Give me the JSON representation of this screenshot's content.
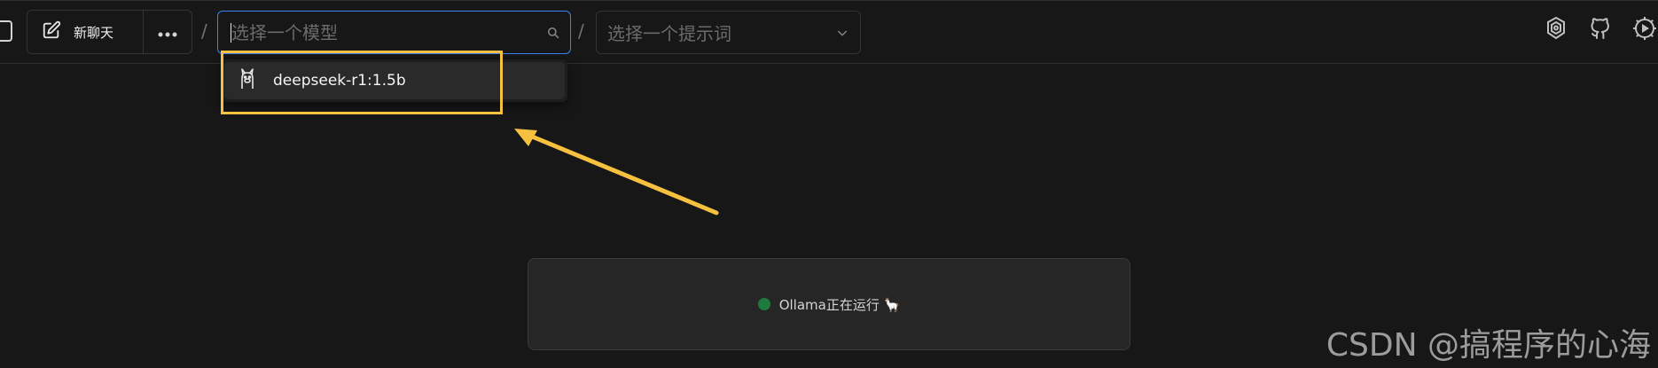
{
  "topbar": {
    "new_chat_label": "新聊天",
    "separator": "/",
    "model_input": {
      "placeholder": "选择一个模型",
      "value": ""
    },
    "prompt_select": {
      "label": "选择一个提示词"
    }
  },
  "dropdown": {
    "items": [
      {
        "label": "deepseek-r1:1.5b",
        "icon": "ollama-llama-icon"
      }
    ]
  },
  "status": {
    "text": "Ollama正在运行 🦙",
    "dot_color": "#1f7a3e"
  },
  "watermark": "CSDN @搞程序的心海",
  "colors": {
    "accent": "#3b82f6",
    "highlight": "#f5c13f",
    "background": "#171717"
  }
}
